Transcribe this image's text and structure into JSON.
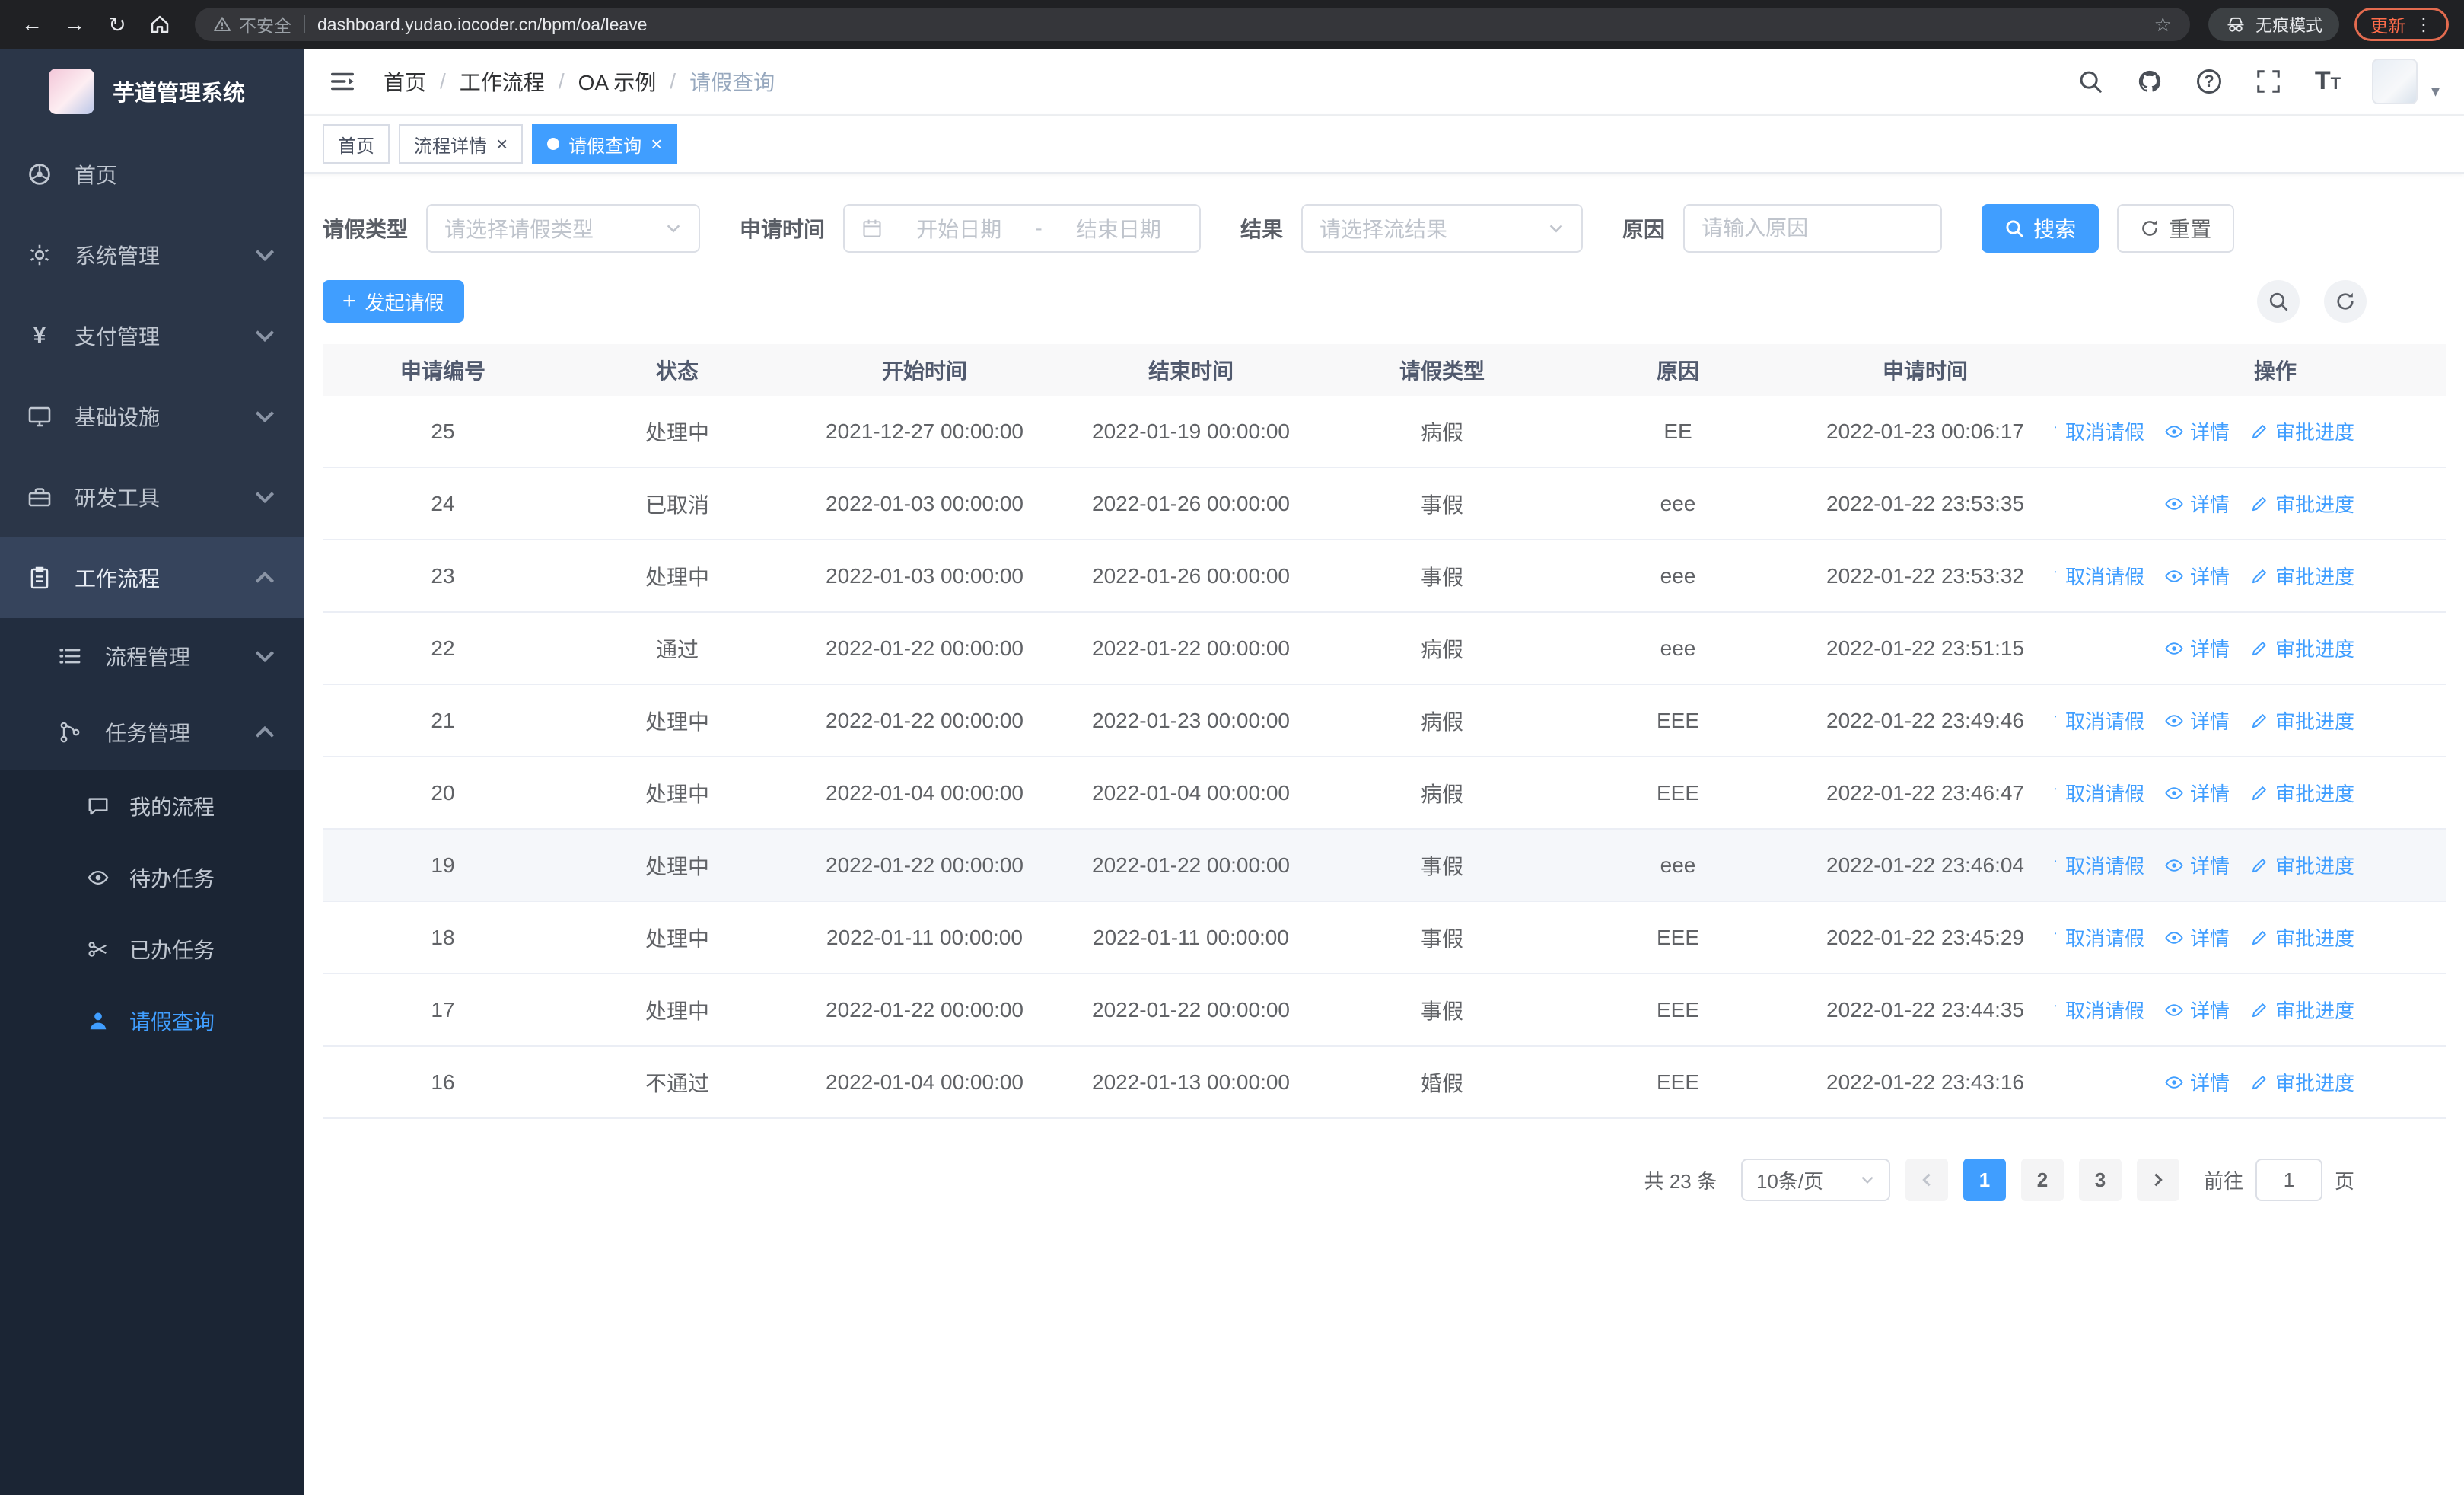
{
  "colors": {
    "primary": "#409eff",
    "sidebar": "#1b2534"
  },
  "icons": {
    "back": "←",
    "forward": "→",
    "reload": "↻",
    "star": "☆",
    "kebab": "⋮",
    "close": "×",
    "plus": "+",
    "caret": "▾",
    "breadcrumb_separator": "/",
    "font_size_big": "T",
    "font_size_small": "T",
    "help": "?"
  },
  "browser": {
    "security_label": "不安全",
    "url": "dashboard.yudao.iocoder.cn/bpm/oa/leave",
    "incognito_label": "无痕模式",
    "update_label": "更新"
  },
  "sidebar": {
    "title": "芋道管理系统",
    "top_items": [
      {
        "label": "首页"
      },
      {
        "label": "系统管理"
      },
      {
        "label": "支付管理"
      },
      {
        "label": "基础设施"
      },
      {
        "label": "研发工具"
      }
    ],
    "workflow": {
      "label": "工作流程"
    },
    "sub_items": [
      {
        "label": "流程管理"
      },
      {
        "label": "任务管理"
      }
    ],
    "leaf_items": [
      {
        "label": "我的流程"
      },
      {
        "label": "待办任务"
      },
      {
        "label": "已办任务"
      },
      {
        "label": "请假查询"
      }
    ]
  },
  "header": {
    "breadcrumb": [
      "首页",
      "工作流程",
      "OA 示例",
      "请假查询"
    ]
  },
  "tabs": [
    {
      "label": "首页"
    },
    {
      "label": "流程详情"
    },
    {
      "label": "请假查询"
    }
  ],
  "filters": {
    "leave_type_label": "请假类型",
    "leave_type_placeholder": "请选择请假类型",
    "apply_time_label": "申请时间",
    "date_start_placeholder": "开始日期",
    "date_separator": "-",
    "date_end_placeholder": "结束日期",
    "result_label": "结果",
    "result_placeholder": "请选择流结果",
    "reason_label": "原因",
    "reason_placeholder": "请输入原因",
    "search_label": "搜索",
    "reset_label": "重置"
  },
  "toolbar": {
    "create_label": "发起请假"
  },
  "table": {
    "columns": [
      "申请编号",
      "状态",
      "开始时间",
      "结束时间",
      "请假类型",
      "原因",
      "申请时间",
      "操作"
    ],
    "action_labels": {
      "cancel": "取消请假",
      "detail": "详情",
      "progress": "审批进度"
    },
    "rows": [
      {
        "id": "25",
        "status": "处理中",
        "start": "2021-12-27 00:00:00",
        "end": "2022-01-19 00:00:00",
        "type": "病假",
        "reason": "EE",
        "apply_time": "2022-01-23 00:06:17",
        "actions": [
          "cancel",
          "detail",
          "progress"
        ],
        "highlighted": false
      },
      {
        "id": "24",
        "status": "已取消",
        "start": "2022-01-03 00:00:00",
        "end": "2022-01-26 00:00:00",
        "type": "事假",
        "reason": "eee",
        "apply_time": "2022-01-22 23:53:35",
        "actions": [
          "detail",
          "progress"
        ],
        "highlighted": false
      },
      {
        "id": "23",
        "status": "处理中",
        "start": "2022-01-03 00:00:00",
        "end": "2022-01-26 00:00:00",
        "type": "事假",
        "reason": "eee",
        "apply_time": "2022-01-22 23:53:32",
        "actions": [
          "cancel",
          "detail",
          "progress"
        ],
        "highlighted": false
      },
      {
        "id": "22",
        "status": "通过",
        "start": "2022-01-22 00:00:00",
        "end": "2022-01-22 00:00:00",
        "type": "病假",
        "reason": "eee",
        "apply_time": "2022-01-22 23:51:15",
        "actions": [
          "detail",
          "progress"
        ],
        "highlighted": false
      },
      {
        "id": "21",
        "status": "处理中",
        "start": "2022-01-22 00:00:00",
        "end": "2022-01-23 00:00:00",
        "type": "病假",
        "reason": "EEE",
        "apply_time": "2022-01-22 23:49:46",
        "actions": [
          "cancel",
          "detail",
          "progress"
        ],
        "highlighted": false
      },
      {
        "id": "20",
        "status": "处理中",
        "start": "2022-01-04 00:00:00",
        "end": "2022-01-04 00:00:00",
        "type": "病假",
        "reason": "EEE",
        "apply_time": "2022-01-22 23:46:47",
        "actions": [
          "cancel",
          "detail",
          "progress"
        ],
        "highlighted": false
      },
      {
        "id": "19",
        "status": "处理中",
        "start": "2022-01-22 00:00:00",
        "end": "2022-01-22 00:00:00",
        "type": "事假",
        "reason": "eee",
        "apply_time": "2022-01-22 23:46:04",
        "actions": [
          "cancel",
          "detail",
          "progress"
        ],
        "highlighted": true
      },
      {
        "id": "18",
        "status": "处理中",
        "start": "2022-01-11 00:00:00",
        "end": "2022-01-11 00:00:00",
        "type": "事假",
        "reason": "EEE",
        "apply_time": "2022-01-22 23:45:29",
        "actions": [
          "cancel",
          "detail",
          "progress"
        ],
        "highlighted": false
      },
      {
        "id": "17",
        "status": "处理中",
        "start": "2022-01-22 00:00:00",
        "end": "2022-01-22 00:00:00",
        "type": "事假",
        "reason": "EEE",
        "apply_time": "2022-01-22 23:44:35",
        "actions": [
          "cancel",
          "detail",
          "progress"
        ],
        "highlighted": false
      },
      {
        "id": "16",
        "status": "不通过",
        "start": "2022-01-04 00:00:00",
        "end": "2022-01-13 00:00:00",
        "type": "婚假",
        "reason": "EEE",
        "apply_time": "2022-01-22 23:43:16",
        "actions": [
          "detail",
          "progress"
        ],
        "highlighted": false
      }
    ]
  },
  "pagination": {
    "total_text": "共 23 条",
    "page_size": "10条/页",
    "pages": [
      "1",
      "2",
      "3"
    ],
    "active_page": "1",
    "goto_label": "前往",
    "goto_value": "1",
    "goto_suffix": "页"
  }
}
